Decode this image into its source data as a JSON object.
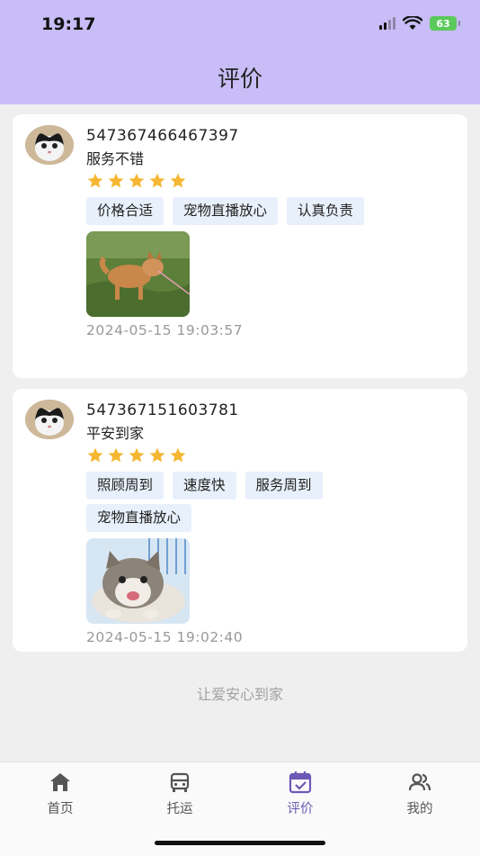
{
  "status_bar": {
    "time": "19:17",
    "battery": "63"
  },
  "page": {
    "title": "评价"
  },
  "reviews": [
    {
      "user_id": "547367466467397",
      "comment": "服务不错",
      "rating": 5,
      "tags": [
        "价格合适",
        "宠物直播放心",
        "认真负责"
      ],
      "time": "2024-05-15 19:03:57",
      "photo": "shiba-dog-photo"
    },
    {
      "user_id": "547367151603781",
      "comment": "平安到家",
      "rating": 5,
      "tags": [
        "照顾周到",
        "速度快",
        "服务周到",
        "宠物直播放心"
      ],
      "time": "2024-05-15 19:02:40",
      "photo": "kitten-photo"
    }
  ],
  "slogan": "让爱安心到家",
  "tabbar": {
    "items": [
      {
        "label": "首页",
        "icon": "home-icon"
      },
      {
        "label": "托运",
        "icon": "car-icon"
      },
      {
        "label": "评价",
        "icon": "calendar-check-icon",
        "active": true
      },
      {
        "label": "我的",
        "icon": "users-icon"
      }
    ]
  },
  "colors": {
    "header": "#c8bdf6",
    "accent": "#6c58b5",
    "star": "#f5b731",
    "tag_bg": "#e8f0fb"
  }
}
